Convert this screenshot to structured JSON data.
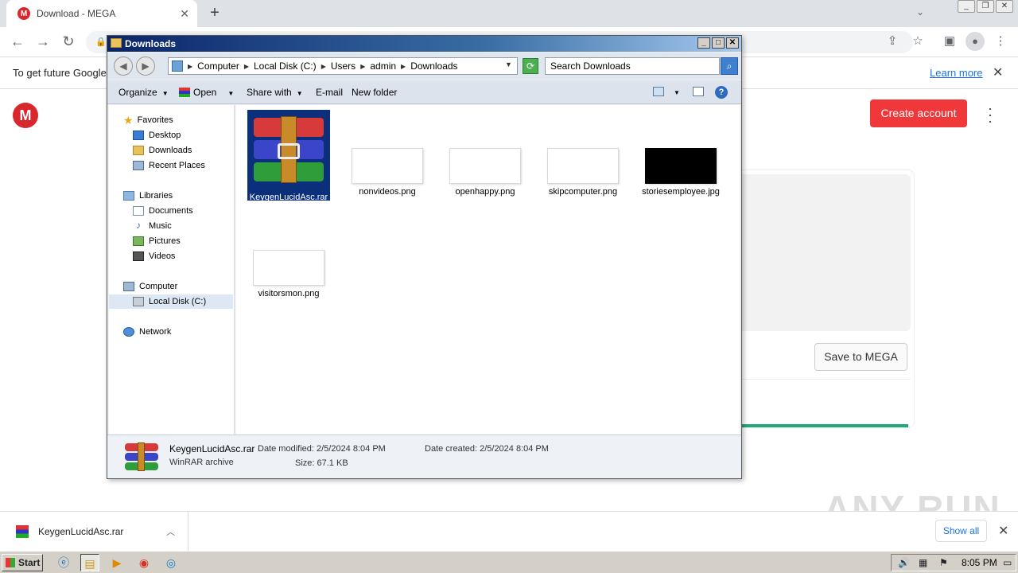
{
  "browser": {
    "tab_title": "Download - MEGA",
    "tab_favicon": "M",
    "infobar_message": "To get future Google",
    "infobar_link": "Learn more"
  },
  "mega": {
    "logo": "M",
    "create_account": "Create account",
    "save_to_mega": "Save to MEGA",
    "progress_fraction": 1.0
  },
  "explorer": {
    "title": "Downloads",
    "breadcrumbs": [
      "Computer",
      "Local Disk (C:)",
      "Users",
      "admin",
      "Downloads"
    ],
    "search_placeholder": "Search Downloads",
    "commands": {
      "organize": "Organize",
      "open": "Open",
      "share_with": "Share with",
      "email": "E-mail",
      "new_folder": "New folder"
    },
    "nav": {
      "favorites": "Favorites",
      "desktop": "Desktop",
      "downloads": "Downloads",
      "recent": "Recent Places",
      "libraries": "Libraries",
      "documents": "Documents",
      "music": "Music",
      "pictures": "Pictures",
      "videos": "Videos",
      "computer": "Computer",
      "local_disk": "Local Disk (C:)",
      "network": "Network"
    },
    "files": [
      "KeygenLucidAsc.rar",
      "nonvideos.png",
      "openhappy.png",
      "skipcomputer.png",
      "storiesemployee.jpg",
      "visitorsmon.png"
    ],
    "details": {
      "name": "KeygenLucidAsc.rar",
      "type": "WinRAR archive",
      "date_modified": "Date modified: 2/5/2024 8:04 PM",
      "size": "Size: 67.1 KB",
      "date_created": "Date created: 2/5/2024 8:04 PM"
    }
  },
  "shelf": {
    "file": "KeygenLucidAsc.rar",
    "show_all": "Show all",
    "watermark": "ANY RUN"
  },
  "taskbar": {
    "start": "Start",
    "clock": "8:05 PM"
  },
  "colors": {
    "mega_red": "#d9272e",
    "create_btn": "#f0373a",
    "progress": "#21a97a",
    "selection": "#0b2f7a",
    "link_blue": "#1a73e8"
  }
}
